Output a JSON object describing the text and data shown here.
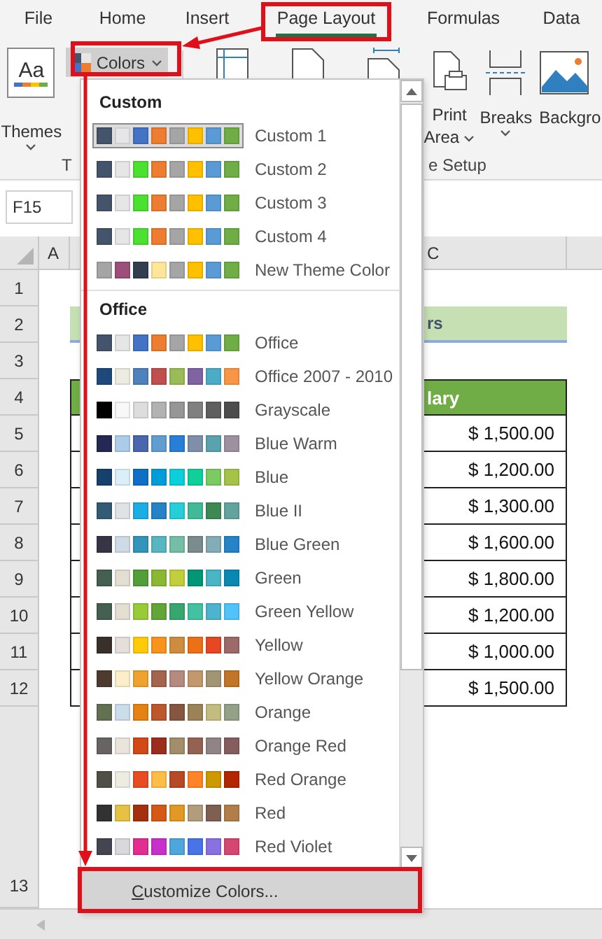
{
  "menu_tabs": [
    {
      "label": "File",
      "selected": false
    },
    {
      "label": "Home",
      "selected": false
    },
    {
      "label": "Insert",
      "selected": false
    },
    {
      "label": "Page Layout",
      "selected": true
    },
    {
      "label": "Formulas",
      "selected": false
    },
    {
      "label": "Data",
      "selected": false
    }
  ],
  "ribbon": {
    "themes": {
      "label": "Themes",
      "icon_text": "Aa"
    },
    "colors": {
      "label": "Colors"
    },
    "print_area": {
      "label_lines": [
        "Print",
        "Area"
      ]
    },
    "breaks": {
      "label": "Breaks"
    },
    "background": {
      "label": "Backgro"
    },
    "group_labels": [
      "T",
      "e Setup"
    ]
  },
  "name_box": "F15",
  "column_headers": [
    "A",
    "C"
  ],
  "row_numbers": [
    "1",
    "2",
    "3",
    "4",
    "5",
    "6",
    "7",
    "8",
    "9",
    "10",
    "11",
    "12",
    "13"
  ],
  "table": {
    "title": "rs",
    "header": "lary",
    "amounts": [
      "$ 1,500.00",
      "$ 1,200.00",
      "$ 1,300.00",
      "$ 1,600.00",
      "$ 1,800.00",
      "$ 1,200.00",
      "$ 1,000.00",
      "$ 1,500.00"
    ]
  },
  "dropdown": {
    "sections": [
      {
        "title": "Custom",
        "items": [
          {
            "label": "Custom 1",
            "selected": true,
            "swatches": [
              {
                "color": "#44546a"
              },
              {
                "color": "#e7e6e6"
              },
              {
                "color": "#4472c4"
              },
              {
                "color": "#ed7d31"
              },
              {
                "color": "#a5a5a5"
              },
              {
                "color": "#ffc000"
              },
              {
                "color": "#5b9bd5"
              },
              {
                "color": "#70ad47"
              }
            ]
          },
          {
            "label": "Custom 2",
            "selected": false,
            "swatches": [
              {
                "color": "#44546a"
              },
              {
                "color": "#e7e6e6"
              },
              {
                "color": "#4ce030"
              },
              {
                "color": "#ed7d31"
              },
              {
                "color": "#a5a5a5"
              },
              {
                "color": "#ffc000"
              },
              {
                "color": "#5b9bd5"
              },
              {
                "color": "#70ad47"
              }
            ]
          },
          {
            "label": "Custom 3",
            "selected": false,
            "swatches": [
              {
                "color": "#44546a"
              },
              {
                "color": "#e7e6e6"
              },
              {
                "color": "#4ce030"
              },
              {
                "color": "#ed7d31"
              },
              {
                "color": "#a5a5a5"
              },
              {
                "color": "#ffc000"
              },
              {
                "color": "#5b9bd5"
              },
              {
                "color": "#70ad47"
              }
            ]
          },
          {
            "label": "Custom 4",
            "selected": false,
            "swatches": [
              {
                "color": "#44546a"
              },
              {
                "color": "#e7e6e6"
              },
              {
                "color": "#4ce030"
              },
              {
                "color": "#ed7d31"
              },
              {
                "color": "#a5a5a5"
              },
              {
                "color": "#ffc000"
              },
              {
                "color": "#5b9bd5"
              },
              {
                "color": "#70ad47"
              }
            ]
          },
          {
            "label": "New Theme Color",
            "selected": false,
            "swatches": [
              {
                "color": "#a5a5a5"
              },
              {
                "color": "#9b4f7a"
              },
              {
                "color": "#323e4f"
              },
              {
                "color": "#ffe699"
              },
              {
                "color": "#a5a5a5"
              },
              {
                "color": "#ffc000"
              },
              {
                "color": "#5b9bd5"
              },
              {
                "color": "#70ad47"
              }
            ]
          }
        ]
      },
      {
        "title": "Office",
        "items": [
          {
            "label": "Office",
            "selected": false,
            "swatches": [
              {
                "color": "#44546a"
              },
              {
                "color": "#e7e6e6"
              },
              {
                "color": "#4472c4"
              },
              {
                "color": "#ed7d31"
              },
              {
                "color": "#a5a5a5"
              },
              {
                "color": "#ffc000"
              },
              {
                "color": "#5b9bd5"
              },
              {
                "color": "#70ad47"
              }
            ]
          },
          {
            "label": "Office 2007 - 2010",
            "selected": false,
            "swatches": [
              {
                "color": "#1f497d"
              },
              {
                "color": "#eeece1"
              },
              {
                "color": "#4f81bd"
              },
              {
                "color": "#c0504d"
              },
              {
                "color": "#9bbb59"
              },
              {
                "color": "#8064a2"
              },
              {
                "color": "#4bacc6"
              },
              {
                "color": "#f79646"
              }
            ]
          },
          {
            "label": "Grayscale",
            "selected": false,
            "swatches": [
              {
                "color": "#000000"
              },
              {
                "color": "#f8f8f8"
              },
              {
                "color": "#dddddd"
              },
              {
                "color": "#b2b2b2"
              },
              {
                "color": "#969696"
              },
              {
                "color": "#808080"
              },
              {
                "color": "#5f5f5f"
              },
              {
                "color": "#4d4d4d"
              }
            ]
          },
          {
            "label": "Blue Warm",
            "selected": false,
            "swatches": [
              {
                "color": "#242852"
              },
              {
                "color": "#acccea"
              },
              {
                "color": "#4a66ac"
              },
              {
                "color": "#629dd1"
              },
              {
                "color": "#297fd5"
              },
              {
                "color": "#7f8fa9"
              },
              {
                "color": "#5aa2ae"
              },
              {
                "color": "#9d90a0"
              }
            ]
          },
          {
            "label": "Blue",
            "selected": false,
            "swatches": [
              {
                "color": "#17406d"
              },
              {
                "color": "#dbeff9"
              },
              {
                "color": "#0f6fc6"
              },
              {
                "color": "#009dd9"
              },
              {
                "color": "#0bd0d9"
              },
              {
                "color": "#10cf9b"
              },
              {
                "color": "#7cca62"
              },
              {
                "color": "#a5c249"
              }
            ]
          },
          {
            "label": "Blue II",
            "selected": false,
            "swatches": [
              {
                "color": "#335b74"
              },
              {
                "color": "#dfe3e5"
              },
              {
                "color": "#1cade4"
              },
              {
                "color": "#2683c6"
              },
              {
                "color": "#27ced7"
              },
              {
                "color": "#42ba97"
              },
              {
                "color": "#3e8853"
              },
              {
                "color": "#62a39f"
              }
            ]
          },
          {
            "label": "Blue Green",
            "selected": false,
            "swatches": [
              {
                "color": "#373545"
              },
              {
                "color": "#cedbe6"
              },
              {
                "color": "#3494ba"
              },
              {
                "color": "#58b6c0"
              },
              {
                "color": "#75bda7"
              },
              {
                "color": "#7a8c8e"
              },
              {
                "color": "#84acb6"
              },
              {
                "color": "#2683c6"
              }
            ]
          },
          {
            "label": "Green",
            "selected": false,
            "swatches": [
              {
                "color": "#455f51"
              },
              {
                "color": "#e3ded1"
              },
              {
                "color": "#549e39"
              },
              {
                "color": "#8ab833"
              },
              {
                "color": "#c0cf3a"
              },
              {
                "color": "#029676"
              },
              {
                "color": "#4ab5c4"
              },
              {
                "color": "#0989b1"
              }
            ]
          },
          {
            "label": "Green Yellow",
            "selected": false,
            "swatches": [
              {
                "color": "#455f51"
              },
              {
                "color": "#e3ded1"
              },
              {
                "color": "#99cb38"
              },
              {
                "color": "#63a537"
              },
              {
                "color": "#37a76f"
              },
              {
                "color": "#44c1a3"
              },
              {
                "color": "#4eb3cf"
              },
              {
                "color": "#51c3f9"
              }
            ]
          },
          {
            "label": "Yellow",
            "selected": false,
            "swatches": [
              {
                "color": "#39302a"
              },
              {
                "color": "#e5dedb"
              },
              {
                "color": "#ffca08"
              },
              {
                "color": "#f8931d"
              },
              {
                "color": "#ce8d3e"
              },
              {
                "color": "#ec7016"
              },
              {
                "color": "#e64823"
              },
              {
                "color": "#9c6a6a"
              }
            ]
          },
          {
            "label": "Yellow Orange",
            "selected": false,
            "swatches": [
              {
                "color": "#4e3b30"
              },
              {
                "color": "#fbeec9"
              },
              {
                "color": "#f0a22e"
              },
              {
                "color": "#a5644e"
              },
              {
                "color": "#b58b80"
              },
              {
                "color": "#c3986d"
              },
              {
                "color": "#a19574"
              },
              {
                "color": "#c17529"
              }
            ]
          },
          {
            "label": "Orange",
            "selected": false,
            "swatches": [
              {
                "color": "#637052"
              },
              {
                "color": "#ccddea"
              },
              {
                "color": "#e48312"
              },
              {
                "color": "#bd582c"
              },
              {
                "color": "#865640"
              },
              {
                "color": "#9b8357"
              },
              {
                "color": "#c2bc80"
              },
              {
                "color": "#94a088"
              }
            ]
          },
          {
            "label": "Orange Red",
            "selected": false,
            "swatches": [
              {
                "color": "#696464"
              },
              {
                "color": "#e9e5dc"
              },
              {
                "color": "#d34817"
              },
              {
                "color": "#9b2d1f"
              },
              {
                "color": "#a28e6a"
              },
              {
                "color": "#956251"
              },
              {
                "color": "#918485"
              },
              {
                "color": "#855d5d"
              }
            ]
          },
          {
            "label": "Red Orange",
            "selected": false,
            "swatches": [
              {
                "color": "#505046"
              },
              {
                "color": "#eeece1"
              },
              {
                "color": "#e84c22"
              },
              {
                "color": "#ffbd47"
              },
              {
                "color": "#b64926"
              },
              {
                "color": "#ff8427"
              },
              {
                "color": "#cc9900"
              },
              {
                "color": "#b22600"
              }
            ]
          },
          {
            "label": "Red",
            "selected": false,
            "swatches": [
              {
                "color": "#323232"
              },
              {
                "color": "#e5c243"
              },
              {
                "color": "#a5300f"
              },
              {
                "color": "#d55816"
              },
              {
                "color": "#e19825"
              },
              {
                "color": "#b19c7d"
              },
              {
                "color": "#7f5f52"
              },
              {
                "color": "#b27d49"
              }
            ]
          },
          {
            "label": "Red Violet",
            "selected": false,
            "swatches": [
              {
                "color": "#454551"
              },
              {
                "color": "#d8d9dc"
              },
              {
                "color": "#e32d91"
              },
              {
                "color": "#c830cc"
              },
              {
                "color": "#4ea6dc"
              },
              {
                "color": "#4775e7"
              },
              {
                "color": "#8971e1"
              },
              {
                "color": "#d54773"
              }
            ]
          }
        ]
      }
    ],
    "footer_button": "Customize Colors..."
  }
}
